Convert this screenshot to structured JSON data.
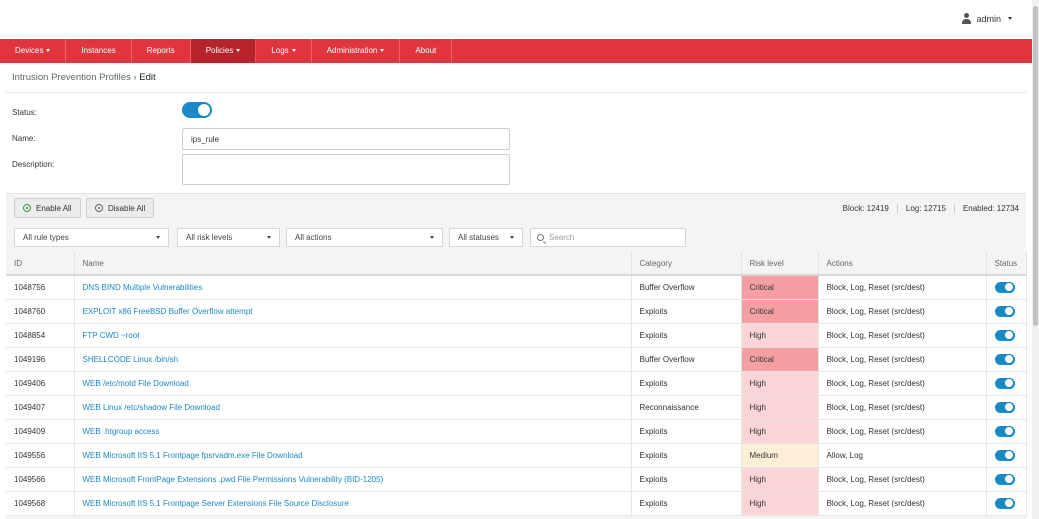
{
  "user": {
    "name": "admin",
    "icon": "user-icon"
  },
  "nav": [
    {
      "label": "Devices",
      "dropdown": true
    },
    {
      "label": "Instances",
      "dropdown": false
    },
    {
      "label": "Reports",
      "dropdown": false
    },
    {
      "label": "Policies",
      "dropdown": true,
      "active": true
    },
    {
      "label": "Logs",
      "dropdown": true
    },
    {
      "label": "Administration",
      "dropdown": true
    },
    {
      "label": "About",
      "dropdown": false
    }
  ],
  "breadcrumb": {
    "parent": "Intrusion Prevention Profiles",
    "separator": "›",
    "current": "Edit"
  },
  "form": {
    "status_label": "Status:",
    "status_on": true,
    "name_label": "Name:",
    "name_value": "ips_rule",
    "description_label": "Description:",
    "description_value": ""
  },
  "toolbar": {
    "enable_all": "Enable All",
    "disable_all": "Disable All",
    "stats": {
      "block": "Block: 12419",
      "log": "Log: 12715",
      "enabled": "Enabled: 12734"
    }
  },
  "filters": {
    "rule_types": "All rule types",
    "risk_levels": "All risk levels",
    "actions": "All actions",
    "statuses": "All statuses",
    "search_placeholder": "Search"
  },
  "table": {
    "headers": [
      "ID",
      "Name",
      "Category",
      "Risk level",
      "Actions",
      "Status"
    ],
    "rows": [
      {
        "id": "1048756",
        "name": "DNS BIND Multiple Vulnerabilities",
        "category": "Buffer Overflow",
        "risk": "Critical",
        "actions": "Block, Log, Reset (src/dest)",
        "enabled": true
      },
      {
        "id": "1048760",
        "name": "EXPLOIT x86 FreeBSD Buffer Overflow attempt",
        "category": "Exploits",
        "risk": "Critical",
        "actions": "Block, Log, Reset (src/dest)",
        "enabled": true
      },
      {
        "id": "1048854",
        "name": "FTP CWD ~root",
        "category": "Exploits",
        "risk": "High",
        "actions": "Block, Log, Reset (src/dest)",
        "enabled": true
      },
      {
        "id": "1049196",
        "name": "SHELLCODE Linux /bin/sh",
        "category": "Buffer Overflow",
        "risk": "Critical",
        "actions": "Block, Log, Reset (src/dest)",
        "enabled": true
      },
      {
        "id": "1049406",
        "name": "WEB /etc/motd File Download",
        "category": "Exploits",
        "risk": "High",
        "actions": "Block, Log, Reset (src/dest)",
        "enabled": true
      },
      {
        "id": "1049407",
        "name": "WEB Linux /etc/shadow File Download",
        "category": "Reconnaissance",
        "risk": "High",
        "actions": "Block, Log, Reset (src/dest)",
        "enabled": true
      },
      {
        "id": "1049409",
        "name": "WEB .htgroup access",
        "category": "Exploits",
        "risk": "High",
        "actions": "Block, Log, Reset (src/dest)",
        "enabled": true
      },
      {
        "id": "1049556",
        "name": "WEB Microsoft IIS 5.1 Frontpage fpsrvadm.exe File Download",
        "category": "Exploits",
        "risk": "Medium",
        "actions": "Allow, Log",
        "enabled": true
      },
      {
        "id": "1049566",
        "name": "WEB Microsoft FrontPage Extensions .pwd File Permissions Vulnerability (BID-1205)",
        "category": "Exploits",
        "risk": "High",
        "actions": "Block, Log, Reset (src/dest)",
        "enabled": true
      },
      {
        "id": "1049568",
        "name": "WEB Microsoft IIS 5.1 Frontpage Server Extensions File Source Disclosure",
        "category": "Exploits",
        "risk": "High",
        "actions": "Block, Log, Reset (src/dest)",
        "enabled": true
      }
    ]
  },
  "colors": {
    "nav_bg": "#e0353f",
    "nav_active": "#b8232b",
    "link": "#1a88c9",
    "toggle_on": "#1a88c9",
    "risk_critical": "#f4a0a2",
    "risk_high": "#fad4d6",
    "risk_medium": "#fcefd6"
  }
}
